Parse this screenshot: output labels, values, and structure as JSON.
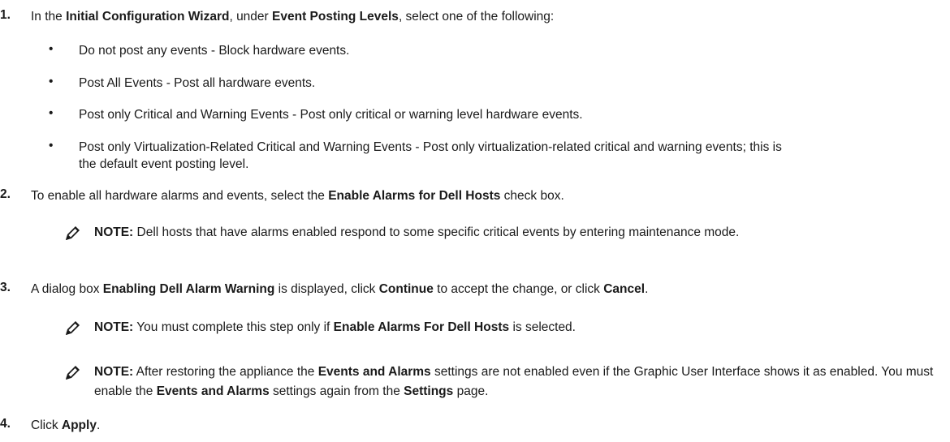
{
  "steps": [
    {
      "num": "1.",
      "t1": "In the ",
      "b1": "Initial Configuration Wizard",
      "t2": ", under ",
      "b2": "Event Posting Levels",
      "t3": ", select one of the following:"
    },
    {
      "num": "2.",
      "t1": "To enable all hardware alarms and events, select the ",
      "b1": "Enable Alarms for Dell Hosts",
      "t2": " check box."
    },
    {
      "num": "3.",
      "t1": "A dialog box ",
      "b1": "Enabling Dell Alarm Warning",
      "t2": " is displayed, click ",
      "b2": "Continue",
      "t3": " to accept the change, or click ",
      "b3": "Cancel",
      "t4": "."
    },
    {
      "num": "4.",
      "t1": "Click ",
      "b1": "Apply",
      "t2": "."
    }
  ],
  "bullet_char": "•",
  "bullets": [
    "Do not post any events - Block hardware events.",
    "Post All Events - Post all hardware events.",
    "Post only Critical and Warning Events - Post only critical or warning level hardware events.",
    "Post only Virtualization-Related Critical and Warning Events - Post only virtualization-related critical and warning events; this is the default event posting level."
  ],
  "notes": [
    {
      "label": "NOTE:",
      "t1": " Dell hosts that have alarms enabled respond to some specific critical events by entering maintenance mode."
    },
    {
      "label": "NOTE:",
      "t1": " You must complete this step only if ",
      "b1": "Enable Alarms For Dell Hosts",
      "t2": " is selected."
    },
    {
      "label": "NOTE:",
      "t1": " After restoring the appliance the ",
      "b1": "Events and Alarms",
      "t2": " settings are not enabled even if the Graphic User Interface shows it as enabled. You must enable the ",
      "b2": "Events and Alarms",
      "t3": " settings again from the ",
      "b3": "Settings",
      "t4": " page."
    }
  ],
  "icons": {
    "note": "note-pencil-icon"
  }
}
